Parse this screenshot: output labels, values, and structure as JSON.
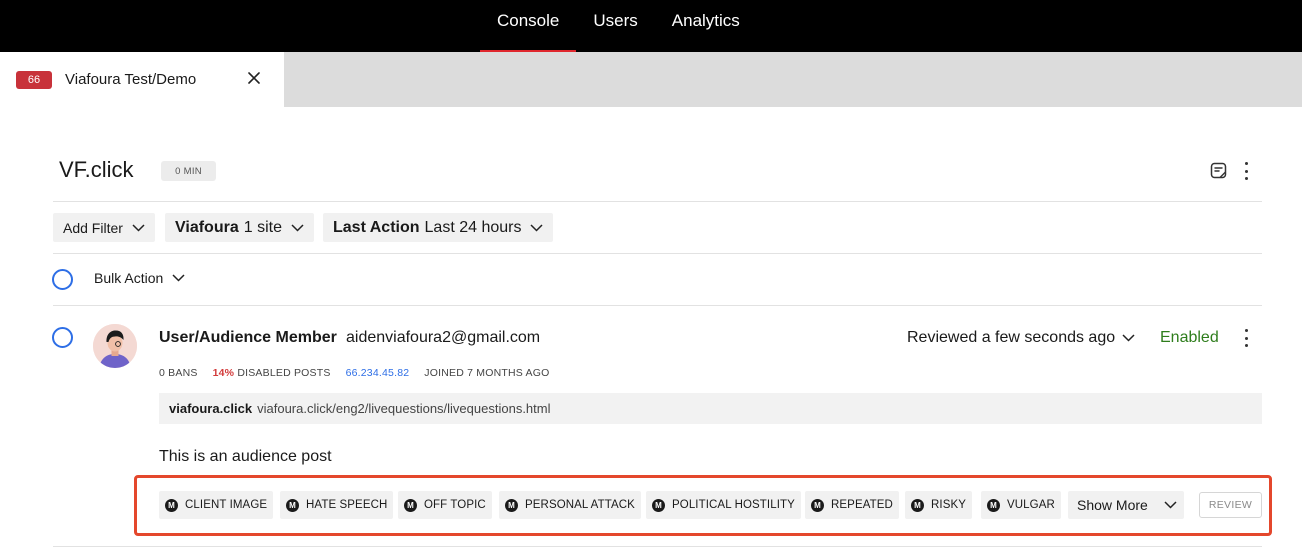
{
  "topnav": {
    "items": [
      "Console",
      "Users",
      "Analytics"
    ],
    "active_index": 0
  },
  "tab": {
    "badge": "66",
    "label": "Viafoura Test/Demo"
  },
  "page": {
    "title": "VF.click",
    "badge": "0 MIN"
  },
  "filters": {
    "add_filter": "Add Filter",
    "site": {
      "bold": "Viafoura",
      "value": "1 site"
    },
    "last_action": {
      "bold": "Last Action",
      "value": "Last 24 hours"
    }
  },
  "bulk_action": "Bulk Action",
  "post": {
    "role": "User/Audience Member",
    "email": "aidenviafoura2@gmail.com",
    "reviewed": "Reviewed a few seconds ago",
    "status": "Enabled",
    "stats": {
      "bans": "0 BANS",
      "disabled_pct": "14%",
      "disabled_label": "DISABLED POSTS",
      "ip": "66.234.45.82",
      "joined": "JOINED 7 MONTHS AGO"
    },
    "url_domain": "viafoura.click",
    "url_path": "viafoura.click/eng2/livequestions/livequestions.html",
    "text": "This is an audience post",
    "tag_icon_letter": "M",
    "tags": [
      "CLIENT IMAGE",
      "HATE SPEECH",
      "OFF TOPIC",
      "PERSONAL ATTACK",
      "POLITICAL HOSTILITY",
      "REPEATED",
      "RISKY",
      "VULGAR"
    ],
    "show_more": "Show More",
    "review": "REVIEW"
  },
  "colors": {
    "accent_blue": "#2d6ee6",
    "enabled_green": "#2e7d1c",
    "badge_red": "#c8323a",
    "highlight_border": "#e4472c"
  }
}
